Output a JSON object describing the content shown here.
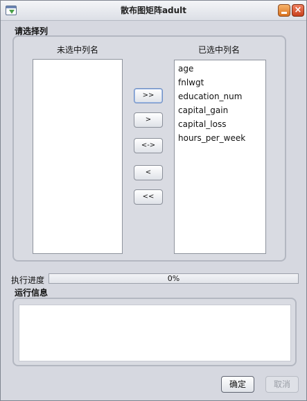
{
  "window": {
    "title": "散布图矩阵adult",
    "icon": "app-window-icon"
  },
  "column_select": {
    "label": "请选择列",
    "unselected_header": "未选中列名",
    "selected_header": "已选中列名",
    "unselected_items": [],
    "selected_items": [
      "age",
      "fnlwgt",
      "education_num",
      "capital_gain",
      "capital_loss",
      "hours_per_week"
    ],
    "buttons": {
      "move_all_right": ">>",
      "move_right": ">",
      "swap": "<->",
      "move_left": "<",
      "move_all_left": "<<"
    }
  },
  "progress": {
    "label": "执行进度",
    "value": 0,
    "text": "0%"
  },
  "run_info": {
    "label": "运行信息",
    "text": ""
  },
  "footer": {
    "ok_label": "确定",
    "cancel_label": "取消"
  },
  "colors": {
    "window_bg": "#d6d8e0",
    "progress_fill": "#6e9be0",
    "close_button": "#c8401e",
    "minimize_button": "#d9721f"
  }
}
